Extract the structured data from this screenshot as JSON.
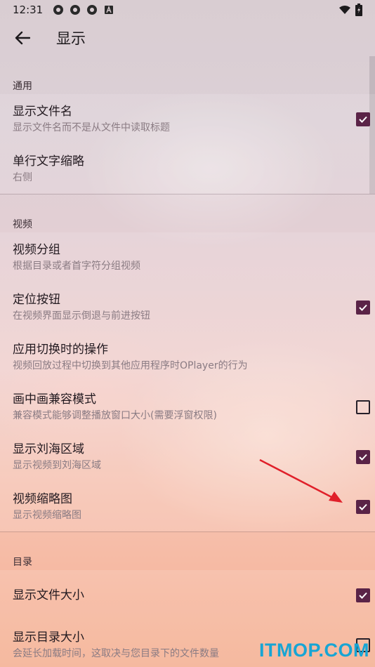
{
  "status_bar": {
    "time": "12:31",
    "icons": [
      "app-icon-1",
      "app-icon-2",
      "app-icon-3",
      "a-badge-icon"
    ],
    "right_icons": [
      "wifi-icon",
      "battery-icon"
    ]
  },
  "app_bar": {
    "title": "显示",
    "back_icon": "back-arrow-icon"
  },
  "sections": [
    {
      "header": "通用",
      "rows": [
        {
          "title": "显示文件名",
          "subtitle": "显示文件名而不是从文件中读取标题",
          "checkbox": true
        },
        {
          "title": "单行文字缩略",
          "subtitle": "右侧",
          "checkbox": null
        }
      ]
    },
    {
      "header": "视频",
      "rows": [
        {
          "title": "视频分组",
          "subtitle": "根据目录或者首字符分组视频",
          "checkbox": null
        },
        {
          "title": "定位按钮",
          "subtitle": "在视频界面显示倒退与前进按钮",
          "checkbox": true
        },
        {
          "title": "应用切换时的操作",
          "subtitle": "视频回放过程中切换到其他应用程序时OPlayer的行为",
          "checkbox": null
        },
        {
          "title": "画中画兼容模式",
          "subtitle": "兼容模式能够调整播放窗口大小(需要浮窗权限)",
          "checkbox": false
        },
        {
          "title": "显示刘海区域",
          "subtitle": "显示视频到刘海区域",
          "checkbox": true
        },
        {
          "title": "视频缩略图",
          "subtitle": "显示视频缩略图",
          "checkbox": true
        }
      ]
    },
    {
      "header": "目录",
      "rows": [
        {
          "title": "显示文件大小",
          "subtitle": "",
          "checkbox": true
        },
        {
          "title": "显示目录大小",
          "subtitle": "会延长加载时间，这取决与您目录下的文件数量",
          "checkbox": false
        }
      ]
    }
  ],
  "colors": {
    "checkbox_checked": "#5a2347",
    "annotation_arrow": "#e0202a",
    "watermark": "#17a5d4"
  },
  "watermark": "ITMOP.COM"
}
